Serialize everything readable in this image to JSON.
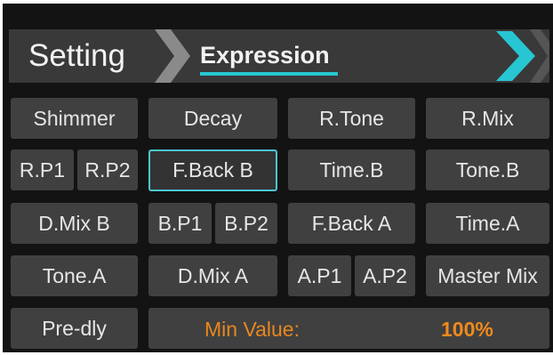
{
  "header": {
    "title": "Setting",
    "active_tab": "Expression",
    "accent_color": "#27c6d2"
  },
  "buttons": {
    "shimmer": "Shimmer",
    "decay": "Decay",
    "r_tone": "R.Tone",
    "r_mix": "R.Mix",
    "r_p1": "R.P1",
    "r_p2": "R.P2",
    "f_back_b": "F.Back B",
    "time_b": "Time.B",
    "tone_b": "Tone.B",
    "d_mix_b": "D.Mix B",
    "b_p1": "B.P1",
    "b_p2": "B.P2",
    "f_back_a": "F.Back A",
    "time_a": "Time.A",
    "tone_a": "Tone.A",
    "d_mix_a": "D.Mix A",
    "a_p1": "A.P1",
    "a_p2": "A.P2",
    "master_mix": "Master Mix",
    "pre_dly": "Pre-dly"
  },
  "selected_button": "F.Back B",
  "value_field": {
    "label": "Min Value:",
    "value": "100%",
    "color": "#ef8a1c"
  }
}
